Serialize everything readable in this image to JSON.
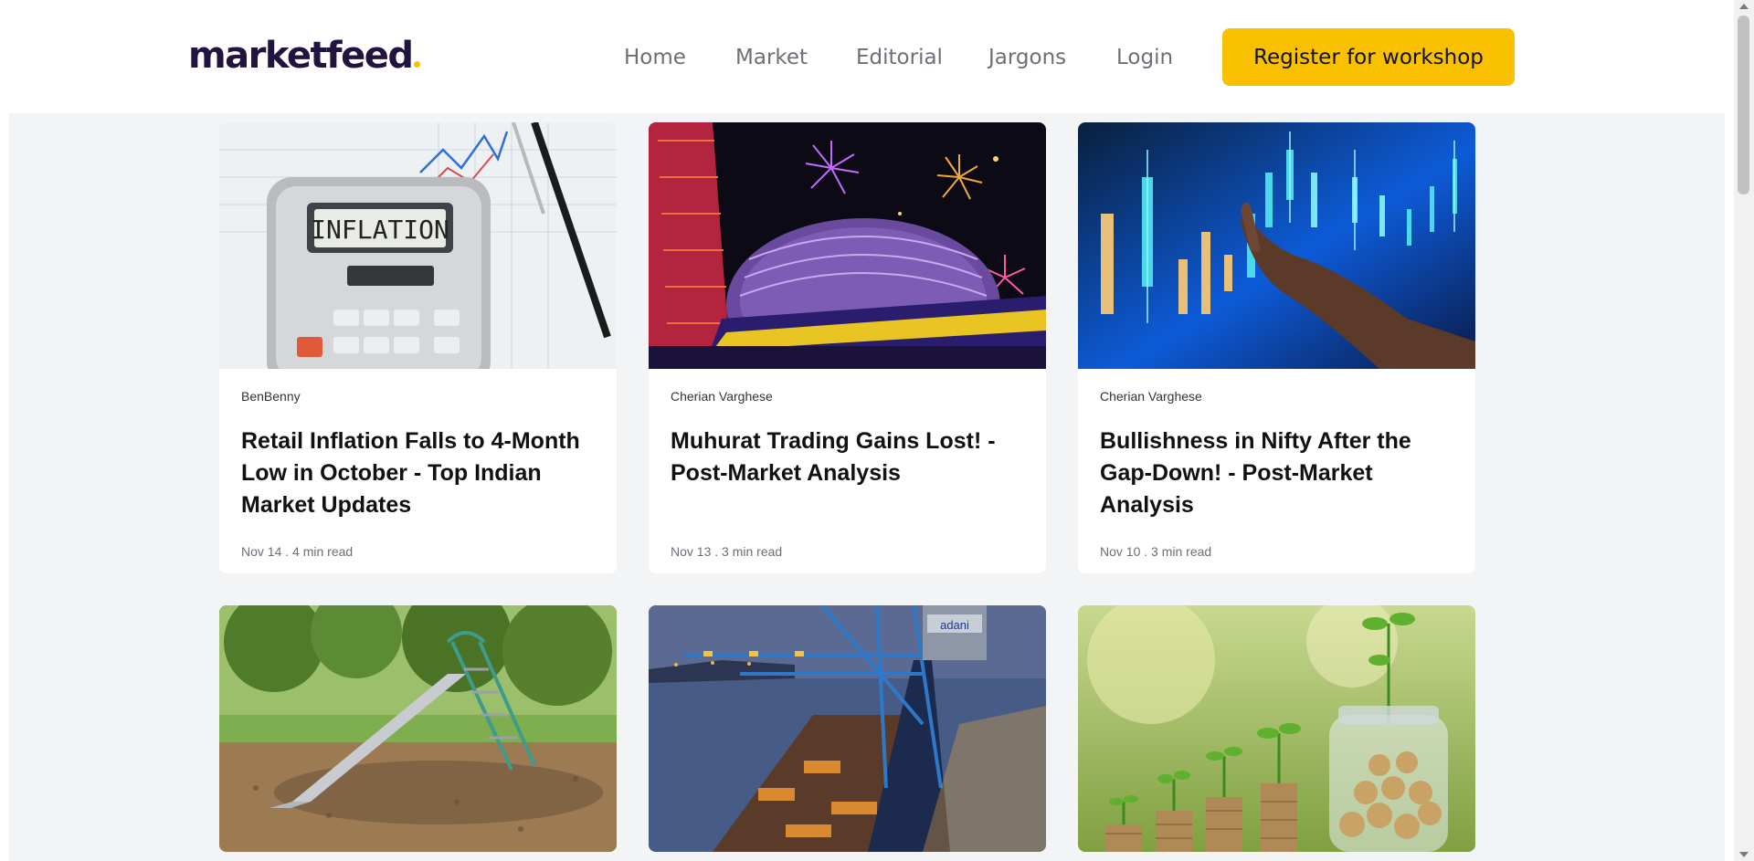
{
  "brand": {
    "logo_text": "marketfeed",
    "accent_color": "#f9c000",
    "logo_color": "#22143f"
  },
  "nav": {
    "items": [
      {
        "label": "Home"
      },
      {
        "label": "Market"
      },
      {
        "label": "Editorial"
      },
      {
        "label": "Jargons"
      },
      {
        "label": "Login"
      }
    ],
    "cta_label": "Register for workshop"
  },
  "articles": [
    {
      "author": "BenBenny",
      "title": "Retail Inflation Falls to 4-Month Low in October - Top Indian Market Updates",
      "meta": "Nov 14 . 4 min read",
      "image": "calculator-inflation-image"
    },
    {
      "author": "Cherian Varghese",
      "title": "Muhurat Trading Gains Lost! - Post-Market Analysis",
      "meta": "Nov 13 . 3 min read",
      "image": "stock-exchange-fireworks-image"
    },
    {
      "author": "Cherian Varghese",
      "title": "Bullishness in Nifty After the Gap-Down! - Post-Market Analysis",
      "meta": "Nov 10 . 3 min read",
      "image": "candlestick-chart-hand-image"
    },
    {
      "image": "playground-slide-image"
    },
    {
      "image": "adani-port-crane-image",
      "image_text": "adani"
    },
    {
      "image": "coin-jar-plants-image"
    }
  ]
}
